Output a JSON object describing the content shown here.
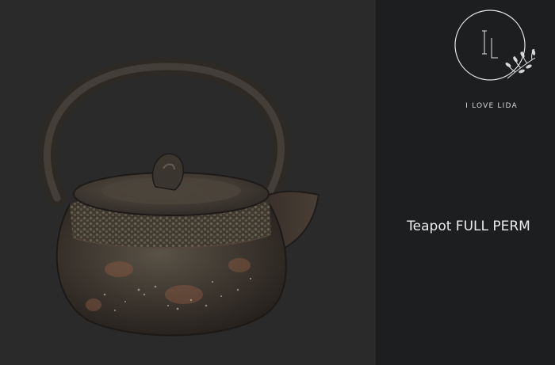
{
  "brand": {
    "name": "I LOVE LIDA",
    "monogram": "IL"
  },
  "product": {
    "title": "Teapot FULL PERM"
  },
  "colors": {
    "left_background": "#2a2a2a",
    "right_background": "#1d1e20",
    "text": "#ececec"
  }
}
